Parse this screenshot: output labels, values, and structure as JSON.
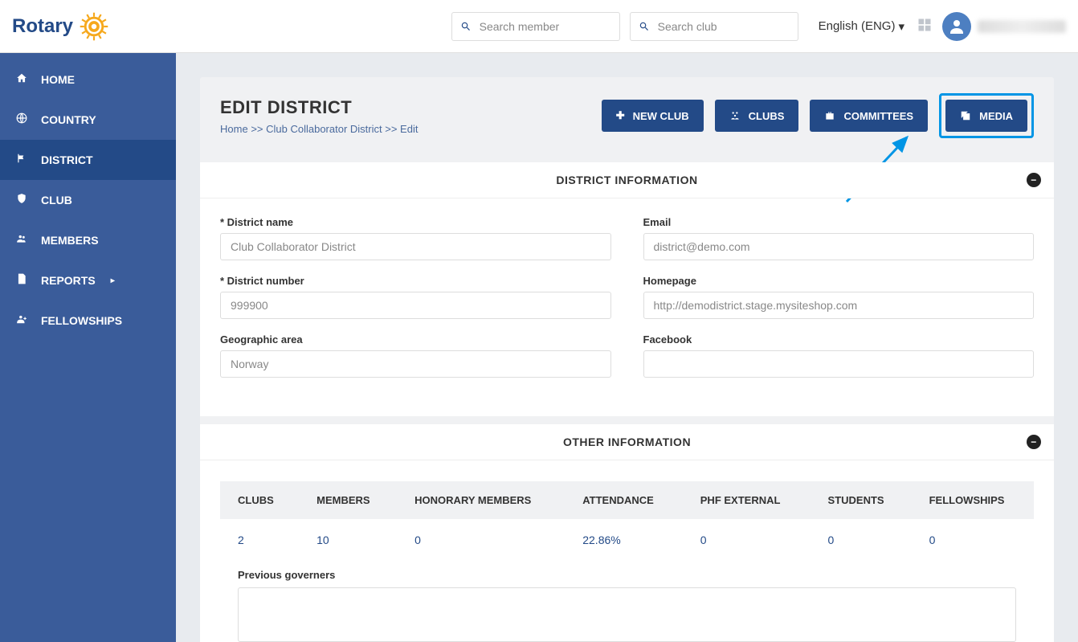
{
  "header": {
    "logo_text": "Rotary",
    "search_member_placeholder": "Search member",
    "search_club_placeholder": "Search club",
    "language": "English (ENG)"
  },
  "sidebar": {
    "items": [
      {
        "label": "HOME",
        "icon": "home"
      },
      {
        "label": "COUNTRY",
        "icon": "globe"
      },
      {
        "label": "DISTRICT",
        "icon": "flag",
        "active": true
      },
      {
        "label": "CLUB",
        "icon": "shield"
      },
      {
        "label": "MEMBERS",
        "icon": "users"
      },
      {
        "label": "REPORTS",
        "icon": "file",
        "caret": true
      },
      {
        "label": "FELLOWSHIPS",
        "icon": "user-plus"
      }
    ]
  },
  "page": {
    "title": "EDIT DISTRICT",
    "breadcrumb_home": "Home",
    "breadcrumb_mid": "Club Collaborator District",
    "breadcrumb_leaf": "Edit",
    "buttons": {
      "new_club": "NEW CLUB",
      "clubs": "CLUBS",
      "committees": "COMMITTEES",
      "media": "MEDIA"
    }
  },
  "district_info": {
    "section_title": "DISTRICT INFORMATION",
    "labels": {
      "name": "* District name",
      "number": "* District number",
      "area": "Geographic area",
      "email": "Email",
      "homepage": "Homepage",
      "facebook": "Facebook"
    },
    "values": {
      "name": "Club Collaborator District",
      "number": "999900",
      "area": "Norway",
      "email": "district@demo.com",
      "homepage": "http://demodistrict.stage.mysiteshop.com",
      "facebook": ""
    }
  },
  "other_info": {
    "section_title": "OTHER INFORMATION",
    "headers": {
      "clubs": "CLUBS",
      "members": "MEMBERS",
      "honorary": "HONORARY MEMBERS",
      "attendance": "ATTENDANCE",
      "phf": "PHF EXTERNAL",
      "students": "STUDENTS",
      "fellowships": "FELLOWSHIPS"
    },
    "values": {
      "clubs": "2",
      "members": "10",
      "honorary": "0",
      "attendance": "22.86%",
      "phf": "0",
      "students": "0",
      "fellowships": "0"
    },
    "prev_gov_label": "Previous governers"
  }
}
